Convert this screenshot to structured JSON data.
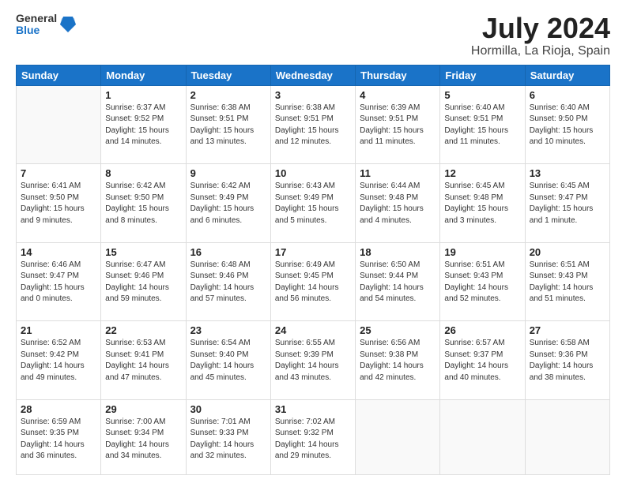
{
  "header": {
    "logo_line1": "General",
    "logo_line2": "Blue",
    "title": "July 2024",
    "subtitle": "Hormilla, La Rioja, Spain"
  },
  "days_of_week": [
    "Sunday",
    "Monday",
    "Tuesday",
    "Wednesday",
    "Thursday",
    "Friday",
    "Saturday"
  ],
  "weeks": [
    [
      {
        "day": "",
        "info": ""
      },
      {
        "day": "1",
        "info": "Sunrise: 6:37 AM\nSunset: 9:52 PM\nDaylight: 15 hours\nand 14 minutes."
      },
      {
        "day": "2",
        "info": "Sunrise: 6:38 AM\nSunset: 9:51 PM\nDaylight: 15 hours\nand 13 minutes."
      },
      {
        "day": "3",
        "info": "Sunrise: 6:38 AM\nSunset: 9:51 PM\nDaylight: 15 hours\nand 12 minutes."
      },
      {
        "day": "4",
        "info": "Sunrise: 6:39 AM\nSunset: 9:51 PM\nDaylight: 15 hours\nand 11 minutes."
      },
      {
        "day": "5",
        "info": "Sunrise: 6:40 AM\nSunset: 9:51 PM\nDaylight: 15 hours\nand 11 minutes."
      },
      {
        "day": "6",
        "info": "Sunrise: 6:40 AM\nSunset: 9:50 PM\nDaylight: 15 hours\nand 10 minutes."
      }
    ],
    [
      {
        "day": "7",
        "info": "Sunrise: 6:41 AM\nSunset: 9:50 PM\nDaylight: 15 hours\nand 9 minutes."
      },
      {
        "day": "8",
        "info": "Sunrise: 6:42 AM\nSunset: 9:50 PM\nDaylight: 15 hours\nand 8 minutes."
      },
      {
        "day": "9",
        "info": "Sunrise: 6:42 AM\nSunset: 9:49 PM\nDaylight: 15 hours\nand 6 minutes."
      },
      {
        "day": "10",
        "info": "Sunrise: 6:43 AM\nSunset: 9:49 PM\nDaylight: 15 hours\nand 5 minutes."
      },
      {
        "day": "11",
        "info": "Sunrise: 6:44 AM\nSunset: 9:48 PM\nDaylight: 15 hours\nand 4 minutes."
      },
      {
        "day": "12",
        "info": "Sunrise: 6:45 AM\nSunset: 9:48 PM\nDaylight: 15 hours\nand 3 minutes."
      },
      {
        "day": "13",
        "info": "Sunrise: 6:45 AM\nSunset: 9:47 PM\nDaylight: 15 hours\nand 1 minute."
      }
    ],
    [
      {
        "day": "14",
        "info": "Sunrise: 6:46 AM\nSunset: 9:47 PM\nDaylight: 15 hours\nand 0 minutes."
      },
      {
        "day": "15",
        "info": "Sunrise: 6:47 AM\nSunset: 9:46 PM\nDaylight: 14 hours\nand 59 minutes."
      },
      {
        "day": "16",
        "info": "Sunrise: 6:48 AM\nSunset: 9:46 PM\nDaylight: 14 hours\nand 57 minutes."
      },
      {
        "day": "17",
        "info": "Sunrise: 6:49 AM\nSunset: 9:45 PM\nDaylight: 14 hours\nand 56 minutes."
      },
      {
        "day": "18",
        "info": "Sunrise: 6:50 AM\nSunset: 9:44 PM\nDaylight: 14 hours\nand 54 minutes."
      },
      {
        "day": "19",
        "info": "Sunrise: 6:51 AM\nSunset: 9:43 PM\nDaylight: 14 hours\nand 52 minutes."
      },
      {
        "day": "20",
        "info": "Sunrise: 6:51 AM\nSunset: 9:43 PM\nDaylight: 14 hours\nand 51 minutes."
      }
    ],
    [
      {
        "day": "21",
        "info": "Sunrise: 6:52 AM\nSunset: 9:42 PM\nDaylight: 14 hours\nand 49 minutes."
      },
      {
        "day": "22",
        "info": "Sunrise: 6:53 AM\nSunset: 9:41 PM\nDaylight: 14 hours\nand 47 minutes."
      },
      {
        "day": "23",
        "info": "Sunrise: 6:54 AM\nSunset: 9:40 PM\nDaylight: 14 hours\nand 45 minutes."
      },
      {
        "day": "24",
        "info": "Sunrise: 6:55 AM\nSunset: 9:39 PM\nDaylight: 14 hours\nand 43 minutes."
      },
      {
        "day": "25",
        "info": "Sunrise: 6:56 AM\nSunset: 9:38 PM\nDaylight: 14 hours\nand 42 minutes."
      },
      {
        "day": "26",
        "info": "Sunrise: 6:57 AM\nSunset: 9:37 PM\nDaylight: 14 hours\nand 40 minutes."
      },
      {
        "day": "27",
        "info": "Sunrise: 6:58 AM\nSunset: 9:36 PM\nDaylight: 14 hours\nand 38 minutes."
      }
    ],
    [
      {
        "day": "28",
        "info": "Sunrise: 6:59 AM\nSunset: 9:35 PM\nDaylight: 14 hours\nand 36 minutes."
      },
      {
        "day": "29",
        "info": "Sunrise: 7:00 AM\nSunset: 9:34 PM\nDaylight: 14 hours\nand 34 minutes."
      },
      {
        "day": "30",
        "info": "Sunrise: 7:01 AM\nSunset: 9:33 PM\nDaylight: 14 hours\nand 32 minutes."
      },
      {
        "day": "31",
        "info": "Sunrise: 7:02 AM\nSunset: 9:32 PM\nDaylight: 14 hours\nand 29 minutes."
      },
      {
        "day": "",
        "info": ""
      },
      {
        "day": "",
        "info": ""
      },
      {
        "day": "",
        "info": ""
      }
    ]
  ]
}
